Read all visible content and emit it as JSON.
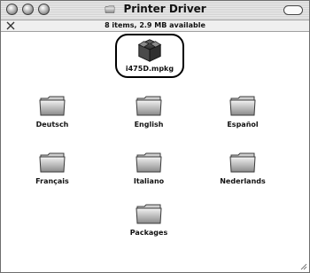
{
  "window": {
    "title": "Printer Driver",
    "status": "8 items, 2.9 MB available"
  },
  "items": [
    {
      "name": "i475D.mpkg",
      "kind": "package-installer"
    },
    {
      "name": "Deutsch",
      "kind": "folder"
    },
    {
      "name": "English",
      "kind": "folder"
    },
    {
      "name": "Español",
      "kind": "folder"
    },
    {
      "name": "Français",
      "kind": "folder"
    },
    {
      "name": "Italiano",
      "kind": "folder"
    },
    {
      "name": "Nederlands",
      "kind": "folder"
    },
    {
      "name": "Packages",
      "kind": "folder"
    }
  ],
  "icons": {
    "title": "folder-icon",
    "status": "toolbar-tools-icon",
    "package": "installer-package-icon",
    "folder": "folder-icon"
  }
}
